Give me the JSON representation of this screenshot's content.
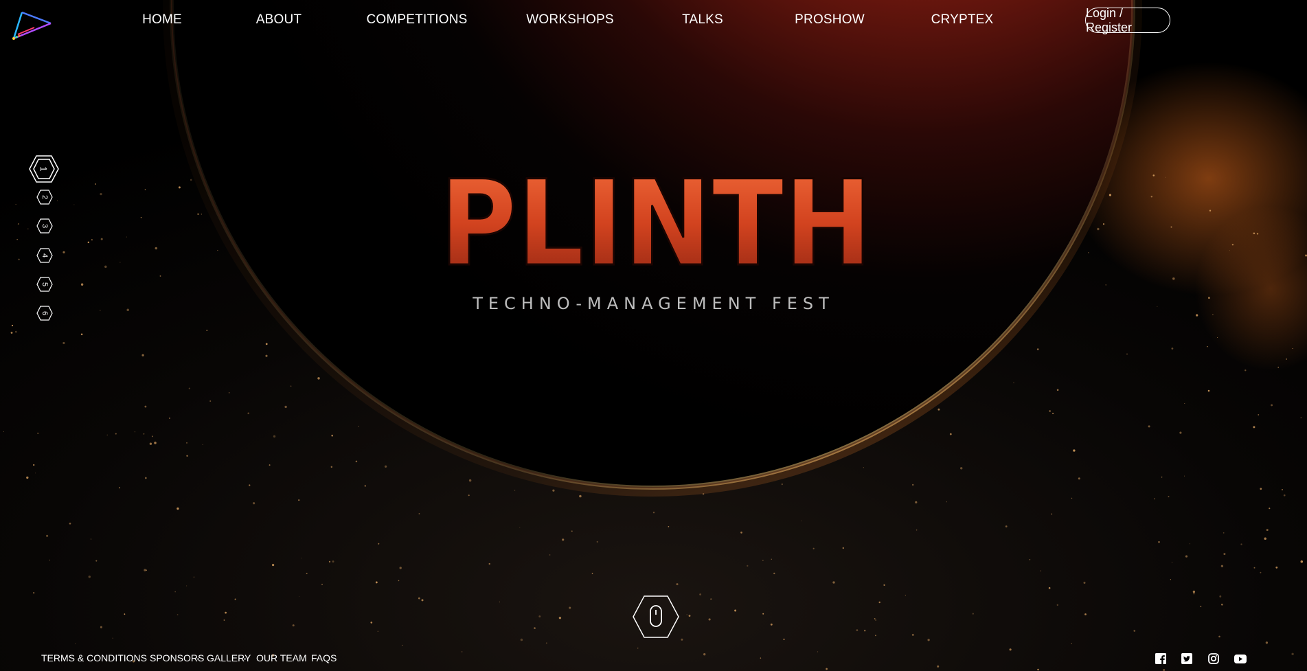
{
  "nav": {
    "items": [
      {
        "label": "HOME"
      },
      {
        "label": "ABOUT"
      },
      {
        "label": "COMPETITIONS"
      },
      {
        "label": "WORKSHOPS"
      },
      {
        "label": "TALKS"
      },
      {
        "label": "PROSHOW"
      },
      {
        "label": "CRYPTEX"
      }
    ],
    "login_label": "Login / Register"
  },
  "logo": {
    "icon": "triangle-play-logo-icon"
  },
  "pager": {
    "pages": [
      "1",
      "2",
      "3",
      "4",
      "5",
      "6"
    ],
    "active": "1"
  },
  "hero": {
    "title": "PLINTH",
    "tagline": "TECHNO-MANAGEMENT FEST",
    "scroll_icon": "mouse-scroll-icon"
  },
  "footer": {
    "links": [
      {
        "label": "TERMS & CONDITIONS"
      },
      {
        "label": "SPONSORS"
      },
      {
        "label": "GALLERY"
      },
      {
        "label": "OUR TEAM"
      },
      {
        "label": "FAQS"
      }
    ]
  },
  "social": [
    "facebook-icon",
    "twitter-icon",
    "instagram-icon",
    "youtube-icon"
  ],
  "colors": {
    "accent": "#e8572a",
    "planet_glow": "#ffd27a",
    "text": "#ffffff",
    "tagline": "#bdbdbd"
  }
}
